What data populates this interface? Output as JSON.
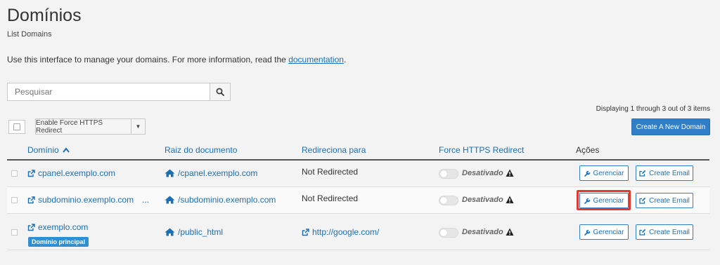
{
  "page": {
    "title": "Domínios",
    "subtitle": "List Domains",
    "intro_prefix": "Use this interface to manage your domains. For more information, read the ",
    "intro_link": "documentation",
    "intro_suffix": "."
  },
  "search": {
    "placeholder": "Pesquisar",
    "button_icon": "search-icon"
  },
  "pagination": {
    "displaying": "Displaying 1 through 3 out of 3 items"
  },
  "toolbar": {
    "https_redirect_label": "Enable Force HTTPS Redirect",
    "create_domain_label": "Create A New Domain"
  },
  "table": {
    "headers": {
      "domain": "Domínio",
      "docroot": "Raiz do documento",
      "redirect": "Redireciona para",
      "https": "Force HTTPS Redirect",
      "actions": "Ações"
    },
    "sort": {
      "column": "domain",
      "direction": "ascending"
    },
    "rows": [
      {
        "domain": "cpanel.exemplo.com",
        "docroot": "/cpanel.exemplo.com",
        "redirect": "Not Redirected",
        "https_status": "Desativado",
        "manage_label": "Gerenciar",
        "email_label": "Create Email"
      },
      {
        "domain": "subdominio.exemplo.com",
        "more": "...",
        "docroot": "/subdominio.exemplo.com",
        "redirect": "Not Redirected",
        "https_status": "Desativado",
        "manage_label": "Gerenciar",
        "email_label": "Create Email"
      },
      {
        "domain": "exemplo.com",
        "badge": "Domínio principal",
        "docroot": "/public_html",
        "redirect": "http://google.com/",
        "https_status": "Desativado",
        "manage_label": "Gerenciar",
        "email_label": "Create Email"
      }
    ]
  },
  "colors": {
    "accent": "#2f7ec7",
    "link": "#1b6fb5",
    "highlight": "#e33a2e",
    "badge": "#2f8fd0"
  }
}
